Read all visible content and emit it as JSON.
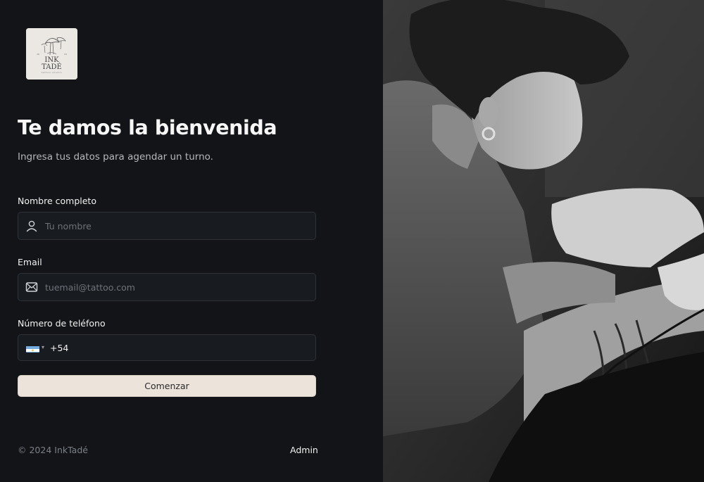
{
  "brand": {
    "logo_text_line1": "INK",
    "logo_text_line2": "TADÉ",
    "logo_sub": "tattoo studio"
  },
  "header": {
    "title": "Te damos la bienvenida",
    "subtitle": "Ingresa tus datos para agendar un turno."
  },
  "form": {
    "name_label": "Nombre completo",
    "name_placeholder": "Tu nombre",
    "name_icon": "user-icon",
    "email_label": "Email",
    "email_placeholder": "tuemail@tattoo.com",
    "email_icon": "mail-icon",
    "phone_label": "Número de teléfono",
    "phone_country_flag": "argentina-flag-icon",
    "phone_code": "+54",
    "phone_value": "",
    "submit_label": "Comenzar"
  },
  "footer": {
    "copyright": "© 2024 InkTadé",
    "admin_link": "Admin"
  },
  "colors": {
    "background": "#121417",
    "input_bg": "#181b1f",
    "input_border": "#2e3238",
    "button_bg": "#ece3da",
    "text_primary": "#f2f2f2",
    "text_muted": "#b5b7bb"
  }
}
